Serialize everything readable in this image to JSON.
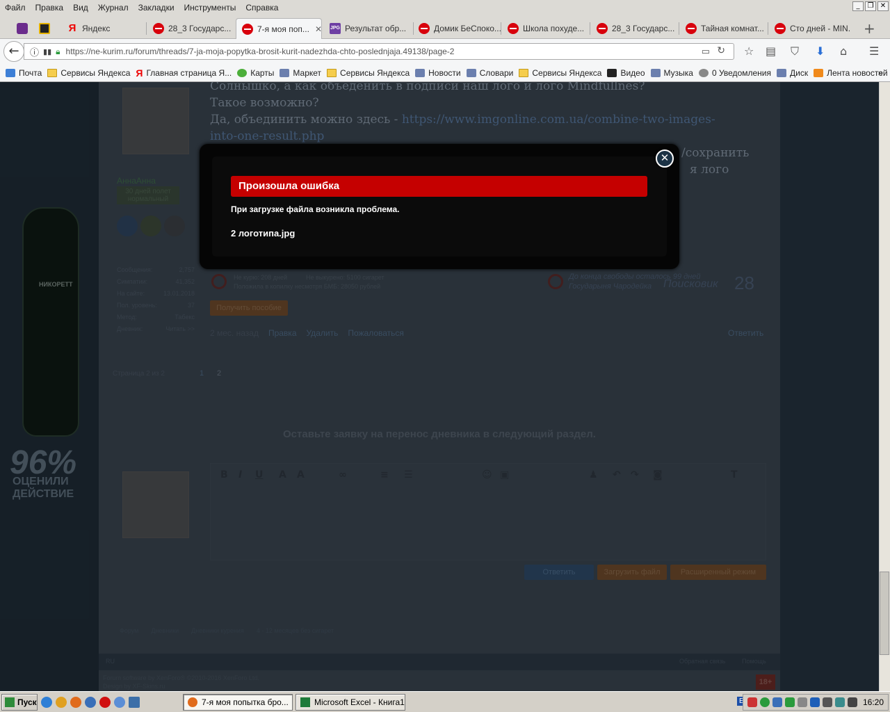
{
  "menu": [
    "Файл",
    "Правка",
    "Вид",
    "Журнал",
    "Закладки",
    "Инструменты",
    "Справка"
  ],
  "tabs": [
    {
      "label": "Яндекс",
      "icon": "yandex-icon"
    },
    {
      "label": "28_3 Государс...",
      "icon": "stop-icon"
    },
    {
      "label": "7-я моя поп...",
      "icon": "stop-icon",
      "active": true
    },
    {
      "label": "Результат обр...",
      "icon": "jpg-icon"
    },
    {
      "label": "Домик БеСпоко...",
      "icon": "stop-icon"
    },
    {
      "label": "Школа похуде...",
      "icon": "stop-icon"
    },
    {
      "label": "28_3 Государс...",
      "icon": "stop-icon"
    },
    {
      "label": "Тайная комнат...",
      "icon": "stop-icon"
    },
    {
      "label": "Сто дней - MIN...",
      "icon": "stop-icon"
    }
  ],
  "url": "https://ne-kurim.ru/forum/threads/7-ja-moja-popytka-brosit-kurit-nadezhda-chto-poslednjaja.49138/page-2",
  "bookmarks": [
    "Почта",
    "Сервисы Яндекса",
    "Главная страница Я...",
    "Карты",
    "Маркет",
    "Сервисы Яндекса",
    "Новости",
    "Словари",
    "Сервисы Яндекса",
    "Видео",
    "Музыка",
    "0 Уведомления",
    "Диск",
    "Лента новостей"
  ],
  "post": {
    "line1": "Солнышко, а как объеденить в подписи наш лого и лого Mindfullnes?",
    "line2": "Такое возможно?",
    "line3_prefix": "Да, объединить можно здесь - ",
    "line3_link": "https://www.imgonline.com.ua/combine-two-images-",
    "line4_link": "into-one-result.php",
    "line5_tail": "/сохранить",
    "line6_tail": "я лого",
    "author": "АннаАнна",
    "author_status": "30 дней полет нормальный",
    "stats": [
      {
        "k": "Сообщения:",
        "v": "2,757"
      },
      {
        "k": "Симпатии:",
        "v": "41,352"
      },
      {
        "k": "На сайте:",
        "v": "13.01.2018"
      },
      {
        "k": "Пол. уровень:",
        "v": "37"
      },
      {
        "k": "Метод:",
        "v": "Табекс"
      },
      {
        "k": "Дневник:",
        "v": "Читать >>"
      }
    ],
    "sig_left1": "Не курю: 208 дней",
    "sig_left2": "Не выкурено: 5100 сигарет",
    "sig_left3": "Положила в копилку несмотря БМБ: 28050 рублей",
    "sig_right": "До конца свободы осталось 99 дней",
    "sig_right2": "Государыня Чародейка",
    "sig_brand": "Поисковик",
    "sig_num": "28",
    "btn_orange": "Получить пособие",
    "meta": "2 мес. назад",
    "actions": [
      "Правка",
      "Удалить",
      "Пожаловаться"
    ],
    "reply": "Ответить"
  },
  "pager": {
    "label": "Страница 2 из 2",
    "pages": [
      "1",
      "2"
    ]
  },
  "notice": "Оставьте заявку на перенос дневника в следующий раздел.",
  "editor_buttons": {
    "reply": "Ответить",
    "upload": "Загрузить файл",
    "advanced": "Расширенный режим"
  },
  "breadcrumb": [
    "Форум",
    "Дневники",
    "Дневники курения",
    "4 - 12 месяцев без сигарет"
  ],
  "footer": {
    "left": "RU",
    "right1": "Обратная связь",
    "right2": "Помощь",
    "copy": "Forum software by XenForo® ©2010-2016 XenForo Ltd.",
    "copy2": "Design by XF-Skins.ru",
    "age": "18+"
  },
  "ad": {
    "big": "96%",
    "line1": "ОЦЕНИЛИ",
    "line2": "ДЕЙСТВИЕ",
    "brand": "НИКОРЕТТ"
  },
  "modal": {
    "title": "Произошла ошибка",
    "message": "При загрузке файла возникла проблема.",
    "file": "2 логотипа.jpg"
  },
  "taskbar": {
    "start": "Пуск",
    "tasks": [
      "7-я моя попытка бро...",
      "Microsoft Excel - Книга1"
    ],
    "lang": "EN",
    "clock": "16:20"
  },
  "colors": {
    "error_red": "#c50000",
    "accent": "#e0832a",
    "link": "#7da0c8"
  }
}
